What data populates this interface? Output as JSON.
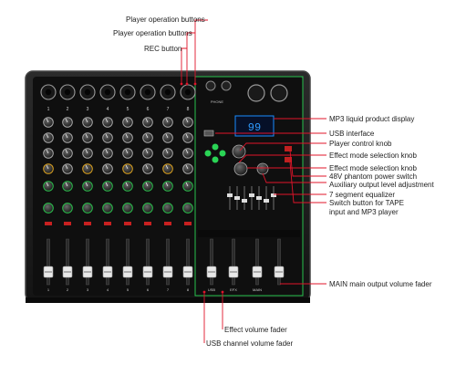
{
  "colors": {
    "chassis": "#1a1a1a",
    "panel": "#0d0d0d",
    "accent_green": "#27c24c",
    "leader_red": "#e0142a",
    "display_blue": "#1a8cff"
  },
  "device": {
    "channel_numbers": [
      "1",
      "2",
      "3",
      "4",
      "5",
      "6",
      "7",
      "8"
    ],
    "display_value": "99",
    "section_labels": [
      "PHONE",
      "MAIN"
    ],
    "fader_labels": [
      "1",
      "2",
      "3",
      "4",
      "5",
      "6",
      "7",
      "8",
      "USB",
      "EFX",
      "MAIN"
    ]
  },
  "callouts": {
    "top": [
      "Player operation buttons",
      "Player operation buttons",
      "REC button"
    ],
    "right": [
      "MP3 liquid product display",
      "USB interface",
      "Player control knob",
      "Effect mode selection knob",
      "Effect mode selection knob",
      "48V phantom power switch",
      "Auxiliary output level adjustment",
      "7 segment equalizer",
      "Switch button for TAPE",
      "input and MP3 player",
      "MAIN main output volume fader"
    ],
    "bottom": [
      "Effect volume fader",
      "USB channel volume fader"
    ]
  }
}
